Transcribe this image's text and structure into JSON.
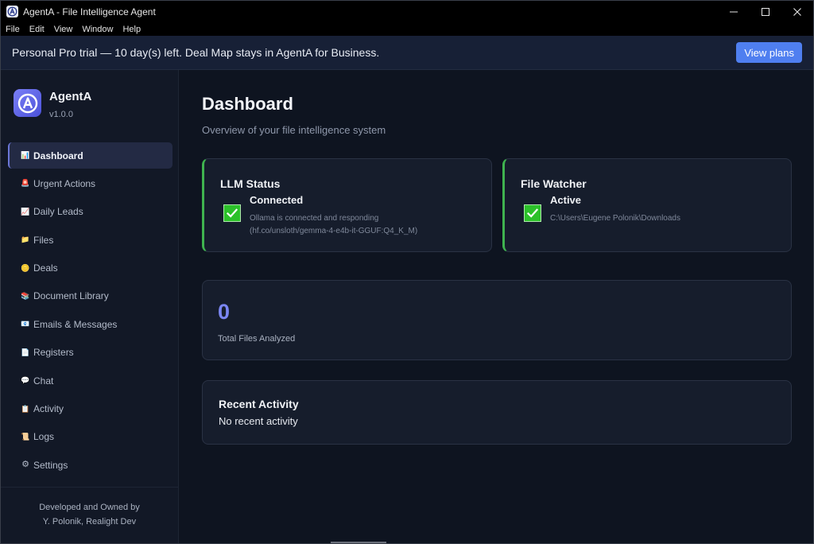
{
  "window": {
    "title": "AgentA - File Intelligence Agent"
  },
  "menu": [
    "File",
    "Edit",
    "View",
    "Window",
    "Help"
  ],
  "banner": {
    "text": "Personal Pro trial — 10 day(s) left. Deal Map stays in AgentA for Business.",
    "button_label": "View plans"
  },
  "brand": {
    "name": "AgentA",
    "version": "v1.0.0"
  },
  "nav": [
    {
      "label": "Dashboard",
      "icon": "chart-icon",
      "glyph": "📊",
      "active": true
    },
    {
      "label": "Urgent Actions",
      "icon": "alarm-icon",
      "glyph": "🚨"
    },
    {
      "label": "Daily Leads",
      "icon": "trend-icon",
      "glyph": "📈"
    },
    {
      "label": "Files",
      "icon": "folder-icon",
      "glyph": "📁"
    },
    {
      "label": "Deals",
      "icon": "coin-icon",
      "glyph": "🪙"
    },
    {
      "label": "Document Library",
      "icon": "books-icon",
      "glyph": "📚"
    },
    {
      "label": "Emails & Messages",
      "icon": "mail-icon",
      "glyph": "📧"
    },
    {
      "label": "Registers",
      "icon": "document-icon",
      "glyph": "📄"
    },
    {
      "label": "Chat",
      "icon": "chat-icon",
      "glyph": "💬"
    },
    {
      "label": "Activity",
      "icon": "clipboard-icon",
      "glyph": "📋"
    },
    {
      "label": "Logs",
      "icon": "scroll-icon",
      "glyph": "📜"
    },
    {
      "label": "Settings",
      "icon": "gear-icon",
      "glyph": "⚙"
    }
  ],
  "footer": {
    "line1": "Developed and Owned by",
    "line2": "Y. Polonik, Realight Dev"
  },
  "dashboard": {
    "title": "Dashboard",
    "subtitle": "Overview of your file intelligence system",
    "llm": {
      "title": "LLM Status",
      "status": "Connected",
      "detail_line1": "Ollama is connected and responding",
      "detail_line2": "(hf.co/unsloth/gemma-4-e4b-it-GGUF:Q4_K_M)"
    },
    "watcher": {
      "title": "File Watcher",
      "status": "Active",
      "detail": "C:\\Users\\Eugene Polonik\\Downloads"
    },
    "stats": {
      "value": "0",
      "label": "Total Files Analyzed"
    },
    "activity": {
      "title": "Recent Activity",
      "empty": "No recent activity"
    }
  },
  "colors": {
    "accent": "#4f7ff0",
    "success": "#2cc12a",
    "stat": "#7b86f2"
  }
}
